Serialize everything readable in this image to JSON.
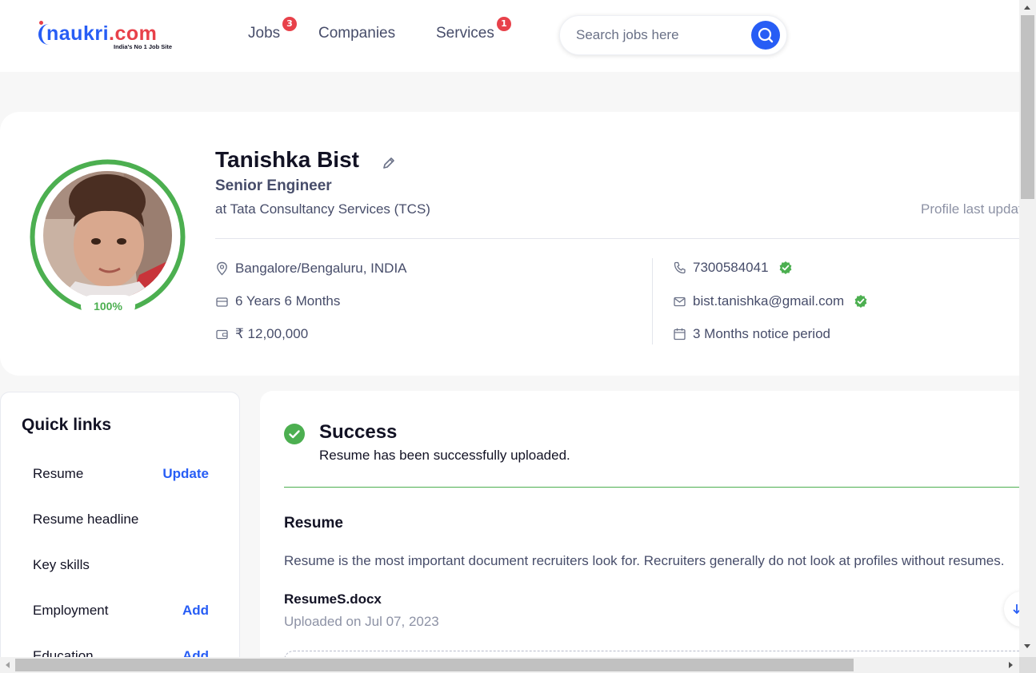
{
  "header": {
    "logo_text": "naukri",
    "logo_domain": ".com",
    "logo_tagline": "India's No 1 Job Site",
    "nav": [
      {
        "label": "Jobs",
        "badge": "3"
      },
      {
        "label": "Companies",
        "badge": ""
      },
      {
        "label": "Services",
        "badge": "1"
      }
    ],
    "search_placeholder": "Search jobs here"
  },
  "profile": {
    "name": "Tanishka Bist",
    "title": "Senior Engineer",
    "company": "at Tata Consultancy Services (TCS)",
    "last_updated": "Profile last updated",
    "completion": "100%",
    "location": "Bangalore/Bengaluru, INDIA",
    "experience": "6 Years 6 Months",
    "salary": "₹ 12,00,000",
    "phone": "7300584041",
    "email": "bist.tanishka@gmail.com",
    "notice": "3 Months notice period"
  },
  "quick_links": {
    "title": "Quick links",
    "items": [
      {
        "label": "Resume",
        "action": "Update"
      },
      {
        "label": "Resume headline",
        "action": ""
      },
      {
        "label": "Key skills",
        "action": ""
      },
      {
        "label": "Employment",
        "action": "Add"
      },
      {
        "label": "Education",
        "action": "Add"
      }
    ]
  },
  "main": {
    "success_title": "Success",
    "success_message": "Resume has been successfully uploaded.",
    "resume_heading": "Resume",
    "resume_description": "Resume is the most important document recruiters look for. Recruiters generally do not look at profiles without resumes.",
    "file_name": "ResumeS.docx",
    "uploaded_on": "Uploaded on Jul 07, 2023"
  },
  "colors": {
    "brand": "#275df5",
    "badge": "#e8414a",
    "success": "#4caf50"
  }
}
